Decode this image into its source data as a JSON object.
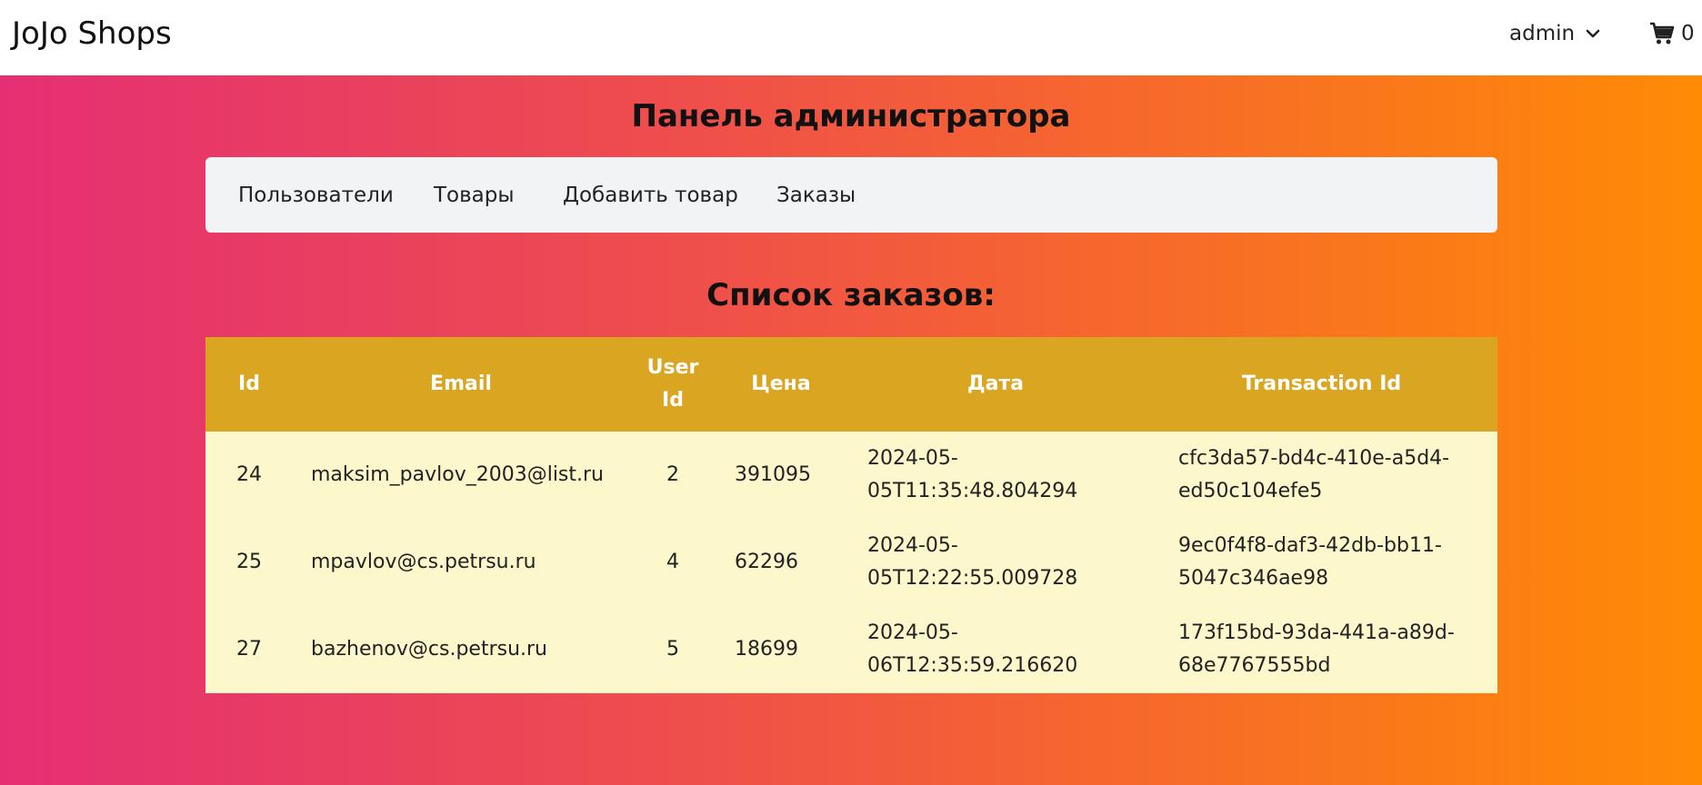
{
  "navbar": {
    "brand": "JoJo Shops",
    "user": "admin",
    "cart_count": "0"
  },
  "page": {
    "title": "Панель администратора",
    "list_title": "Список заказов:"
  },
  "admin_nav": {
    "items": [
      {
        "label": "Пользователи"
      },
      {
        "label": "Товары"
      },
      {
        "label": "Добавить товар"
      },
      {
        "label": "Заказы"
      }
    ]
  },
  "orders": {
    "headers": {
      "id": "Id",
      "email": "Email",
      "user_id": "User Id",
      "price": "Цена",
      "date": "Дата",
      "transaction_id": "Transaction Id"
    },
    "rows": [
      {
        "id": "24",
        "email": "maksim_pavlov_2003@list.ru",
        "user_id": "2",
        "price": "391095",
        "date": "2024-05-05T11:35:48.804294",
        "transaction_id": "cfc3da57-bd4c-410e-a5d4-ed50c104efe5"
      },
      {
        "id": "25",
        "email": "mpavlov@cs.petrsu.ru",
        "user_id": "4",
        "price": "62296",
        "date": "2024-05-05T12:22:55.009728",
        "transaction_id": "9ec0f4f8-daf3-42db-bb11-5047c346ae98"
      },
      {
        "id": "27",
        "email": "bazhenov@cs.petrsu.ru",
        "user_id": "5",
        "price": "18699",
        "date": "2024-05-06T12:35:59.216620",
        "transaction_id": "173f15bd-93da-441a-a89d-68e7767555bd"
      }
    ]
  },
  "colors": {
    "gradient_start": "#e52f74",
    "gradient_end": "#ff8b05",
    "table_header": "#daa520",
    "table_body": "#fdf7cc",
    "nav_panel": "#f2f3f5"
  },
  "icons": {
    "user_dropdown": "chevron-down-icon",
    "cart": "shopping-cart-icon"
  }
}
